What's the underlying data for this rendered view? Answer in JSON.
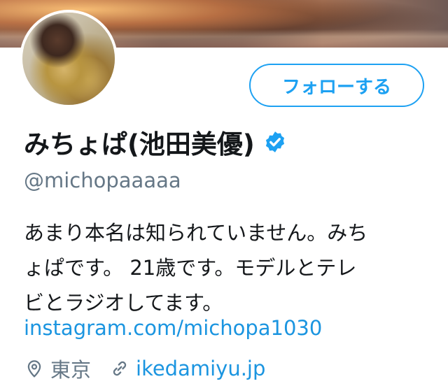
{
  "profile": {
    "name": "みちょぱ(池田美優)",
    "handle": "@michopaaaaa",
    "follow_label": "フォローする",
    "bio_lines": [
      "あまり本名は知られていません。みち",
      "ょぱです。 21歳です。モデルとテレ",
      "ビとラジオしてます。"
    ],
    "bio_link": "instagram.com/michopa1030",
    "location": "東京",
    "website": "ikedamiyu.jp",
    "verified": true
  },
  "icons": {
    "verified": "verified-badge-icon",
    "location": "location-pin-icon",
    "website": "link-icon"
  },
  "colors": {
    "accent": "#1da1f2",
    "link": "#1b95e0",
    "secondary_text": "#657786",
    "primary_text": "#14171a"
  }
}
